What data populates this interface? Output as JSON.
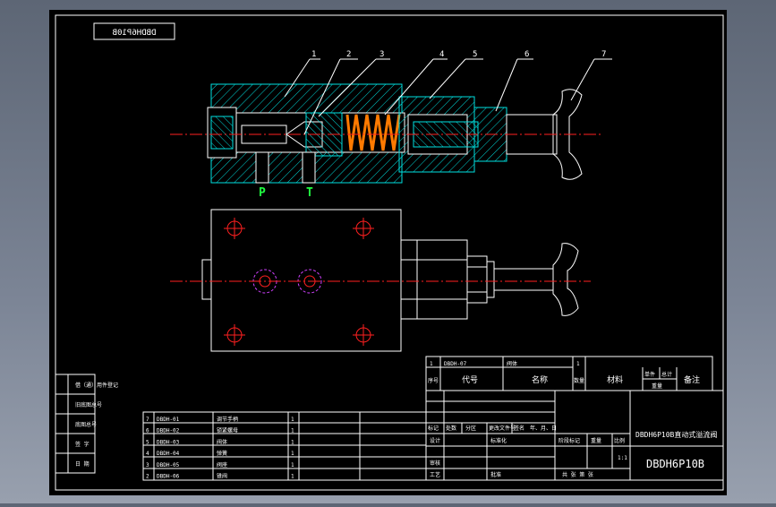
{
  "drawing": {
    "stamp_mirrored": "DBDH6P10B",
    "balloons": [
      "1",
      "2",
      "3",
      "4",
      "5",
      "6",
      "7"
    ],
    "port_labels": [
      "P",
      "T"
    ]
  },
  "left_block_rows": [
    "借（通）用件登记",
    "旧底图总号",
    "底图总号",
    "签 字",
    "日 期"
  ],
  "parts_list": [
    {
      "no": "7",
      "code": "DBDH-01",
      "name": "调节手柄",
      "qty": "1"
    },
    {
      "no": "6",
      "code": "DBDH-02",
      "name": "锁紧螺母",
      "qty": "1"
    },
    {
      "no": "5",
      "code": "DBDH-03",
      "name": "阀体",
      "qty": "1"
    },
    {
      "no": "4",
      "code": "DBDH-04",
      "name": "弹簧",
      "qty": "1"
    },
    {
      "no": "3",
      "code": "DBDH-05",
      "name": "阀座",
      "qty": "1"
    },
    {
      "no": "2",
      "code": "DBDH-06",
      "name": "锥阀",
      "qty": "1"
    }
  ],
  "bom_row": {
    "no": "1",
    "code": "DBDH-07",
    "name": "阀体",
    "qty": "1"
  },
  "bom_header": {
    "no": "序号",
    "code": "代号",
    "name": "名称",
    "qty": "数量",
    "material": "材料",
    "unit": "单件",
    "total": "总计",
    "weight": "重量",
    "remark": "备注"
  },
  "title_block": {
    "title": "DBDH6P10B直动式溢流阀",
    "drawing_no": "DBDH6P10B",
    "scale": "1:1",
    "rev_headers": [
      "标记",
      "处数",
      "分区",
      "更改文件号",
      "签名",
      "年、月、日"
    ],
    "design": "设计",
    "standard": "标准化",
    "check": "审核",
    "process": "工艺",
    "approve": "批准",
    "stage": "阶段标记",
    "weight": "重量",
    "ratio": "比例",
    "sheets": "共 张 第 张"
  }
}
